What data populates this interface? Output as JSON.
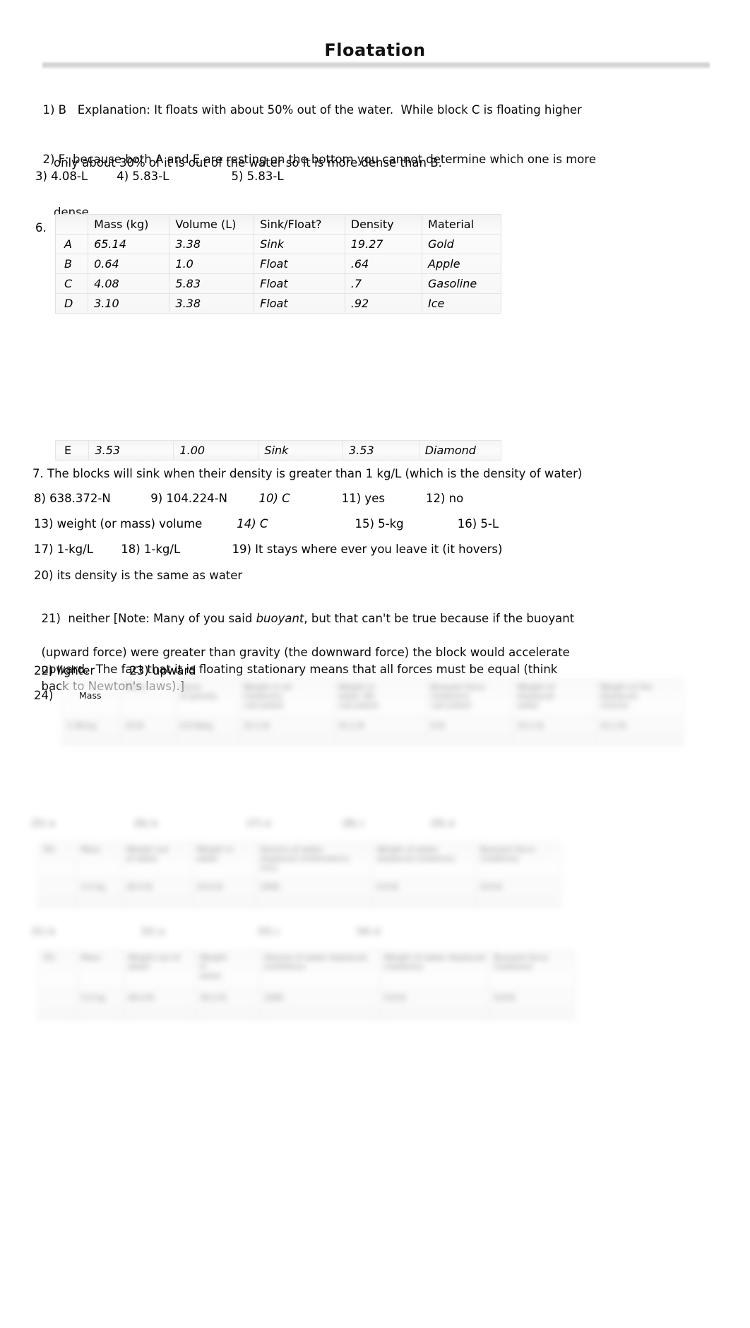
{
  "document": {
    "title": "Floatation"
  },
  "answers": {
    "a1": {
      "line1": "1) B   Explanation: It floats with about 50% out of the water.  While block C is floating higher",
      "line2": "only about 30% of it is out of the water so it is more dense than B."
    },
    "a2": {
      "line1": "2) F; because both A and E are resting on the bottom you cannot determine which one is more",
      "line2": "dense."
    },
    "row345": [
      {
        "label": "3) 4.08-L"
      },
      {
        "label": "4) 5.83-L"
      },
      {
        "label": "5) 5.83-L"
      }
    ],
    "a6_number": "6.",
    "a7": "7. The blocks will sink when their density is greater than 1 kg/L (which is the density of water)",
    "row8to12": [
      {
        "label": "8) 638.372-N"
      },
      {
        "label": "9) 104.224-N"
      },
      {
        "label": "10) C",
        "italic": true
      },
      {
        "label": "11) yes"
      },
      {
        "label": "12) no"
      }
    ],
    "row13to16": [
      {
        "label": "13) weight (or mass)  volume"
      },
      {
        "label": "14)  C",
        "italic": true
      },
      {
        "label": "15) 5-kg"
      },
      {
        "label": "16) 5-L"
      }
    ],
    "row17to19": [
      {
        "label": "17)  1-kg/L"
      },
      {
        "label": "18) 1-kg/L"
      },
      {
        "label": "19) It stays where ever you leave it (it hovers)"
      }
    ],
    "a20": "20) its density is the same as water",
    "a21": {
      "line1_pre": "21)  neither [Note: Many of you said ",
      "line1_italic": "buoyant",
      "line1_post": ", but that can't be true because if the buoyant",
      "line2": "(upward force) were greater than gravity (the downward force) the block would accelerate",
      "line3": "upward.  The fact that it is floating stationary means that all forces must be equal (think",
      "line4": "back to Newton's laws).]"
    },
    "row22to23": [
      {
        "label": "22) lighter"
      },
      {
        "label": "23) upward"
      }
    ],
    "a24_number": "24)",
    "a24_visible_label": "Mass"
  },
  "table6": {
    "headers": [
      "",
      "Mass  (kg)",
      "Volume  (L)",
      "Sink/Float?",
      "Density",
      "Material"
    ],
    "rows": [
      {
        "letter": "A",
        "mass": "65.14",
        "volume": "3.38",
        "sink_float": "Sink",
        "density": "19.27",
        "material": "Gold"
      },
      {
        "letter": "B",
        "mass": "0.64",
        "volume": "1.0",
        "sink_float": "Float",
        "density": ".64",
        "material": "Apple"
      },
      {
        "letter": "C",
        "mass": "4.08",
        "volume": "5.83",
        "sink_float": "Float",
        "density": ".7",
        "material": "Gasoline"
      },
      {
        "letter": "D",
        "mass": "3.10",
        "volume": "3.38",
        "sink_float": "Float",
        "density": ".92",
        "material": "Ice"
      }
    ],
    "row_e": {
      "letter": "E",
      "mass": "3.53",
      "volume": "1.00",
      "sink_float": "Sink",
      "density": "3.53",
      "material": "Diamond"
    }
  },
  "blurred_region": {
    "note": "bottom tables are visually blurred and illegible in the source image",
    "table_a": {
      "headers": [
        "Mass",
        "",
        "",
        "",
        "",
        "",
        "",
        ""
      ],
      "rows": [
        [
          "",
          "",
          "",
          "",
          "",
          "",
          "",
          ""
        ]
      ]
    },
    "line_a": [
      "",
      "",
      "",
      "",
      ""
    ],
    "table_b": {
      "headers": [
        "",
        "",
        "",
        "",
        "",
        ""
      ],
      "rows": [
        [
          "",
          "",
          "",
          "",
          "",
          ""
        ]
      ]
    },
    "line_b": [
      "",
      "",
      "",
      ""
    ],
    "table_c": {
      "headers": [
        "",
        "",
        "",
        "",
        "",
        ""
      ],
      "rows": [
        [
          "",
          "",
          "",
          "",
          "",
          ""
        ]
      ]
    }
  }
}
